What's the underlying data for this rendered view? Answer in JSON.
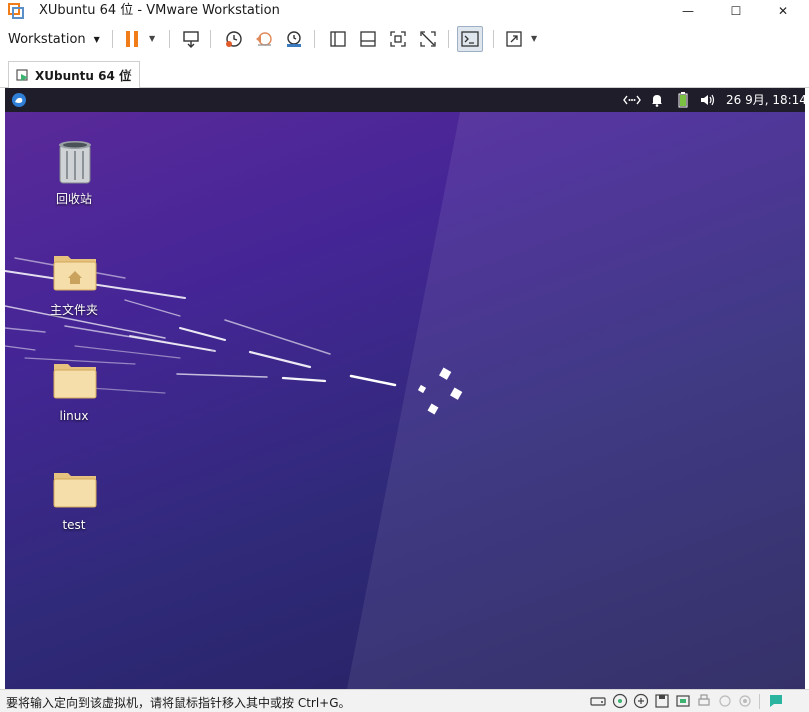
{
  "window": {
    "title": "XUbuntu 64 位 - VMware Workstation",
    "controls": {
      "minimize": "—",
      "maximize": "☐",
      "close": "✕"
    }
  },
  "toolbar": {
    "menu_label": "Workstation",
    "buttons": [
      "pause-icon",
      "send-ctrl-alt-del-icon",
      "snapshot-take-icon",
      "snapshot-revert-icon",
      "snapshot-manager-icon",
      "console-view-icon",
      "thumbnail-bar-icon",
      "full-screen-icon",
      "unity-icon",
      "terminal-icon",
      "stretch-guest-icon"
    ]
  },
  "tab": {
    "label": "XUbuntu 64 位",
    "close": "✕"
  },
  "guest": {
    "panel": {
      "clock": "26 9月, 18:14"
    },
    "desktop_icons": [
      {
        "label": "回收站",
        "icon": "trash-icon"
      },
      {
        "label": "主文件夹",
        "icon": "home-folder-icon"
      },
      {
        "label": "linux",
        "icon": "folder-icon"
      },
      {
        "label": "test",
        "icon": "folder-icon"
      }
    ]
  },
  "statusbar": {
    "message": "要将输入定向到该虚拟机，请将鼠标指针移入其中或按 Ctrl+G。"
  },
  "colors": {
    "desktop_gradient": [
      "#5c2a9a",
      "#24205c"
    ],
    "panel": "#201d2a",
    "pause_accent": "#f07c1a",
    "battery": "#7ac143"
  }
}
